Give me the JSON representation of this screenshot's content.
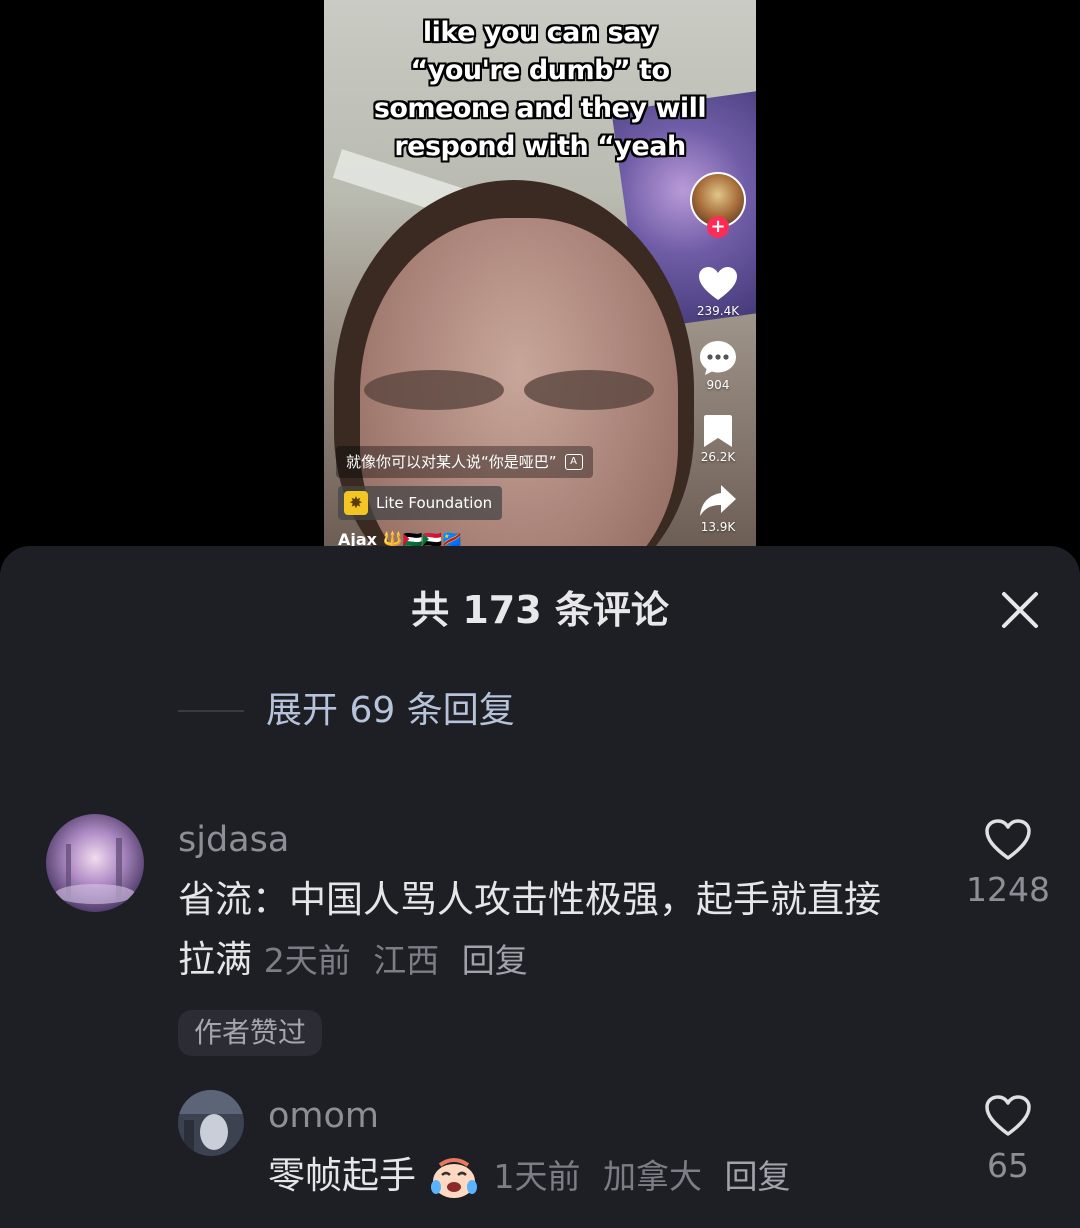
{
  "video": {
    "caption": "like you can say “you're dumb” to someone and they will respond with “yeah",
    "translation": "就像你可以对某人说“你是哑巴”",
    "sound_label": "Lite Foundation",
    "author": "Ajax 🔱🇵🇸🇸🇩🇨🇩",
    "likes": "239.4K",
    "comments": "904",
    "saves": "26.2K",
    "shares": "13.9K"
  },
  "sheet": {
    "title": "共 173 条评论",
    "expand_replies": "展开 69 条回复"
  },
  "comments": [
    {
      "user": "sjdasa",
      "text_line1": "省流：中国人骂人攻击性极强，起手就直接",
      "text_line2": "拉满",
      "time": "2天前",
      "location": "江西",
      "reply": "回复",
      "likes": "1248",
      "badge": "作者赞过"
    },
    {
      "user": "omom",
      "text": "零帧起手",
      "time": "1天前",
      "location": "加拿大",
      "reply": "回复",
      "likes": "65"
    }
  ],
  "colors": {
    "sheet_bg": "#1e1f25",
    "accent_link": "#b7c3da",
    "follow_plus": "#fe2c55"
  }
}
